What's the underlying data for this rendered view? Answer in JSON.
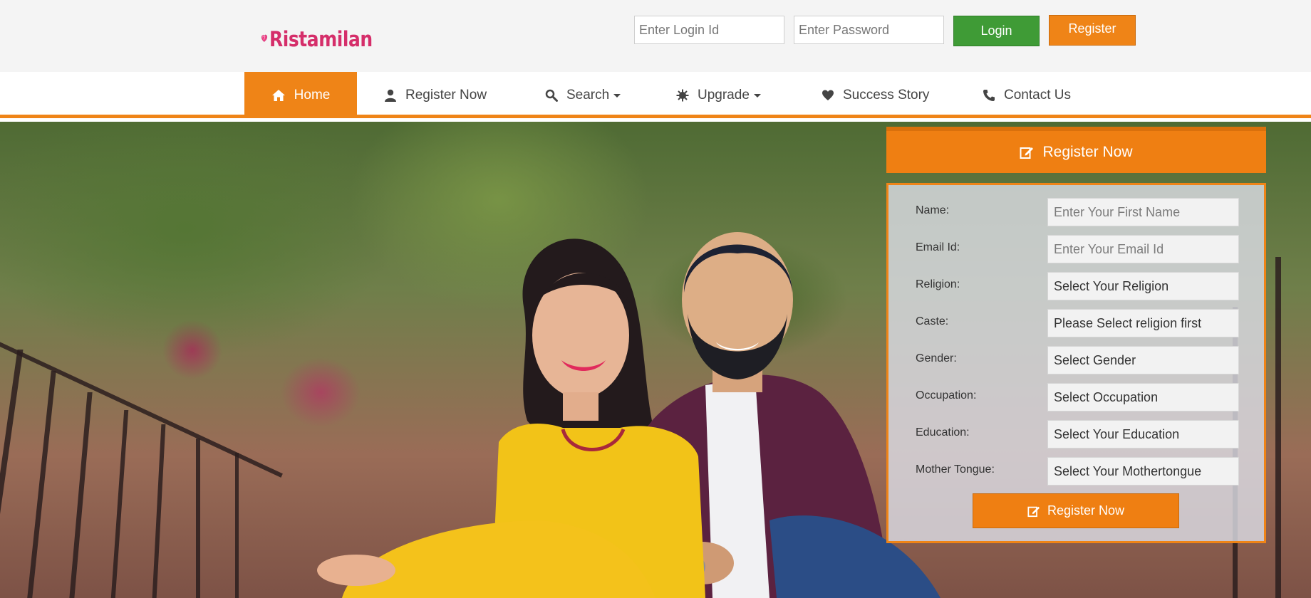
{
  "header": {
    "logo_text": "Ristamilan",
    "login_id_placeholder": "Enter Login Id",
    "password_placeholder": "Enter Password",
    "login_label": "Login",
    "register_label": "Register"
  },
  "nav": {
    "items": [
      {
        "label": "Home",
        "icon": "home-icon",
        "active": true
      },
      {
        "label": "Register Now",
        "icon": "user-icon"
      },
      {
        "label": "Search",
        "icon": "search-icon",
        "dropdown": true
      },
      {
        "label": "Upgrade",
        "icon": "cog-icon",
        "dropdown": true
      },
      {
        "label": "Success Story",
        "icon": "heart-icon"
      },
      {
        "label": "Contact Us",
        "icon": "phone-icon"
      }
    ]
  },
  "register_panel": {
    "title": "Register Now",
    "title_icon": "edit-icon",
    "fields": [
      {
        "label": "Name:",
        "value": "Enter Your First Name",
        "placeholder": true
      },
      {
        "label": "Email Id:",
        "value": "Enter Your Email Id",
        "placeholder": true
      },
      {
        "label": "Religion:",
        "value": "Select Your Religion"
      },
      {
        "label": "Caste:",
        "value": "Please Select religion first"
      },
      {
        "label": "Gender:",
        "value": "Select Gender"
      },
      {
        "label": "Occupation:",
        "value": "Select Occupation"
      },
      {
        "label": "Education:",
        "value": "Select Your Education"
      },
      {
        "label": "Mother Tongue:",
        "value": "Select Your Mothertongue"
      }
    ],
    "submit_label": "Register Now"
  },
  "colors": {
    "accent": "#ef8417",
    "login_green": "#3f9b36",
    "brand_pink": "#d52e6a"
  }
}
